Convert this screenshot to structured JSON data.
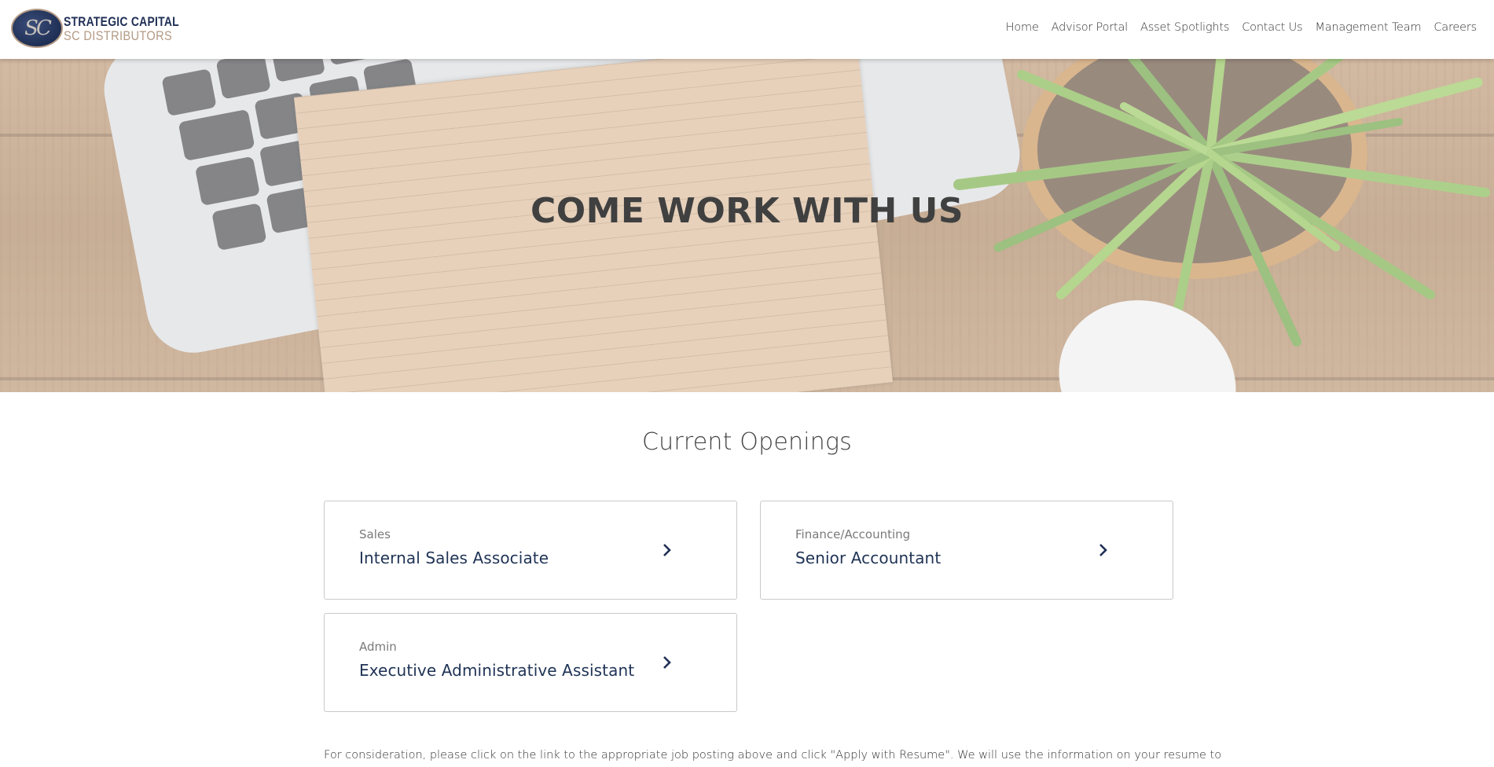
{
  "brand": {
    "badge": "SC",
    "line1": "STRATEGIC CAPITAL",
    "line2": "SC DISTRIBUTORS"
  },
  "nav": {
    "items": [
      {
        "label": "Home"
      },
      {
        "label": "Advisor Portal"
      },
      {
        "label": "Asset Spotlights"
      },
      {
        "label": "Contact Us"
      },
      {
        "label": "Management Team"
      },
      {
        "label": "Careers"
      }
    ]
  },
  "hero": {
    "title": "COME WORK WITH US"
  },
  "openings": {
    "title": "Current Openings",
    "jobs": [
      {
        "category": "Sales",
        "title": "Internal Sales Associate",
        "icon": "chevron-right-icon"
      },
      {
        "category": "Finance/Accounting",
        "title": "Senior Accountant",
        "icon": "chevron-right-icon"
      },
      {
        "category": "Admin",
        "title": "Executive Administrative Assistant",
        "icon": "chevron-right-icon"
      }
    ]
  },
  "footnote": "For consideration, please click on the link to the appropriate job posting above and click \"Apply with Resume\". We will use the information on your resume to",
  "colors": {
    "brand_navy": "#1f2f55",
    "brand_tan": "#b39a84",
    "job_title": "#1f3355"
  }
}
